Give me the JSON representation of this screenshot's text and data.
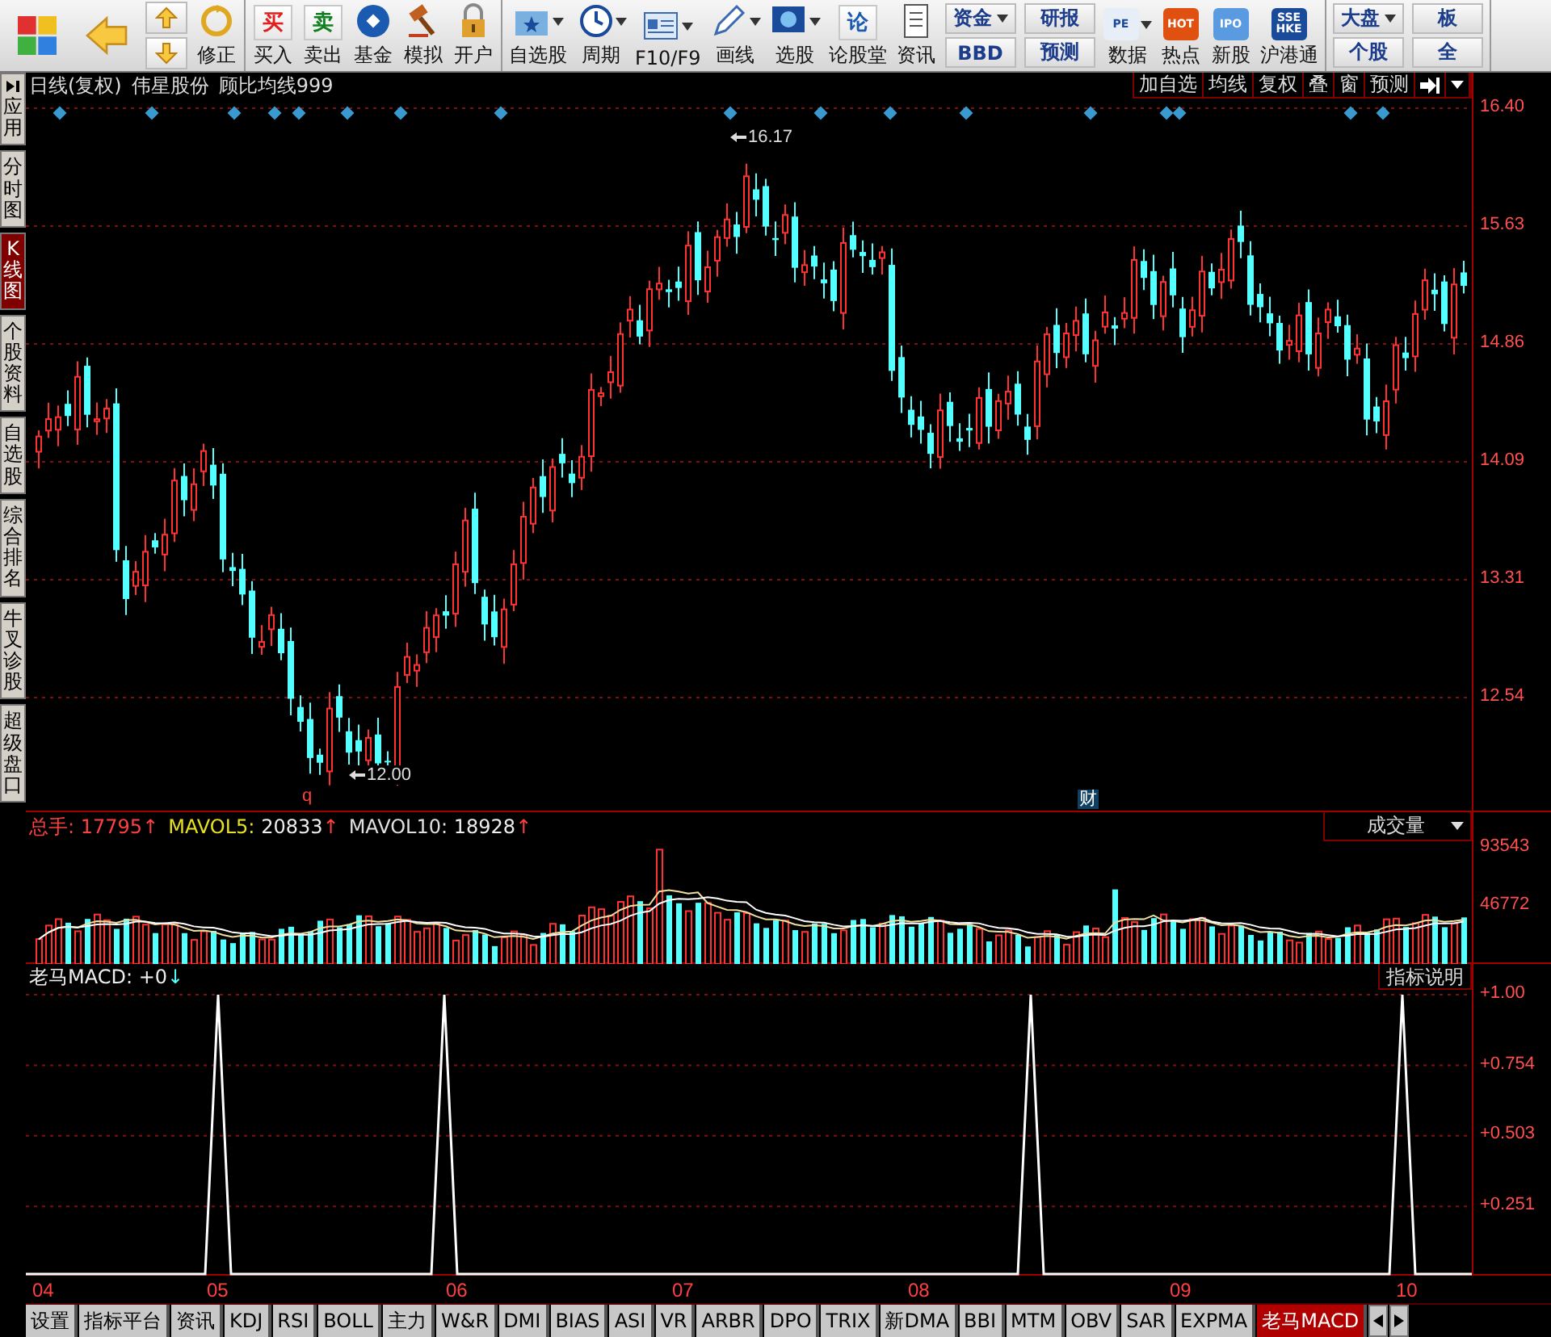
{
  "toolbar": {
    "groups": [
      [
        {
          "kind": "icon",
          "dropdown": false
        },
        {
          "kind": "icon",
          "dropdown": false
        },
        {
          "kind": "arrows"
        },
        {
          "kind": "icon",
          "label": "修正",
          "dropdown": false
        }
      ],
      [
        {
          "kind": "glyph",
          "glyph": "买",
          "label": "买入",
          "dropdown": false
        },
        {
          "kind": "glyph",
          "glyph": "卖",
          "label": "卖出",
          "dropdown": false
        },
        {
          "kind": "icon",
          "label": "基金",
          "dropdown": false
        },
        {
          "kind": "icon",
          "label": "模拟",
          "dropdown": false
        },
        {
          "kind": "icon",
          "label": "开户",
          "dropdown": false
        }
      ],
      [
        {
          "kind": "icon",
          "label": "自选股",
          "dropdown": true
        },
        {
          "kind": "icon",
          "label": "周期",
          "dropdown": true
        },
        {
          "kind": "icon",
          "label": "F10/F9",
          "dropdown": true
        },
        {
          "kind": "icon",
          "label": "画线",
          "dropdown": true
        },
        {
          "kind": "icon",
          "label": "选股",
          "dropdown": true
        },
        {
          "kind": "glyph",
          "glyph": "论",
          "label": "论股堂",
          "dropdown": false
        },
        {
          "kind": "icon",
          "label": "资讯",
          "dropdown": false
        },
        {
          "kind": "stack",
          "buttons": [
            {
              "label": "资金",
              "dropdown": true
            },
            {
              "label": "BBD",
              "dropdown": false
            }
          ]
        },
        {
          "kind": "stack",
          "buttons": [
            {
              "label": "研报",
              "dropdown": false
            },
            {
              "label": "预测",
              "dropdown": false
            }
          ]
        },
        {
          "kind": "glyph",
          "glyph": "PE",
          "label": "数据",
          "dropdown": true
        },
        {
          "kind": "glyph",
          "glyph": "HOT",
          "label": "热点",
          "dropdown": false
        },
        {
          "kind": "glyph",
          "glyph": "IPO",
          "label": "新股",
          "dropdown": false
        },
        {
          "kind": "glyph",
          "glyph": "SSE HKE",
          "label": "沪港通",
          "dropdown": false
        }
      ],
      [
        {
          "kind": "stack",
          "buttons": [
            {
              "label": "大盘",
              "dropdown": true
            },
            {
              "label": "个股",
              "dropdown": false
            }
          ]
        },
        {
          "kind": "stack",
          "buttons": [
            {
              "label": "板",
              "dropdown": false
            },
            {
              "label": "全",
              "dropdown": false
            }
          ]
        }
      ]
    ]
  },
  "sidebar": {
    "items": [
      {
        "label": "应用",
        "selected": false
      },
      {
        "label": "分时图",
        "selected": false
      },
      {
        "label": "K线图",
        "selected": true
      },
      {
        "label": "个股资料",
        "selected": false
      },
      {
        "label": "自选股",
        "selected": false
      },
      {
        "label": "综合排名",
        "selected": false
      },
      {
        "label": "牛叉诊股",
        "selected": false
      },
      {
        "label": "超级盘口",
        "selected": false
      }
    ]
  },
  "price_chart": {
    "title": [
      "日线(复权)",
      "伟星股份",
      "顾比均线999"
    ],
    "buttons": [
      "加自选",
      "均线",
      "复权",
      "叠",
      "窗",
      "预测"
    ],
    "high_label": "16.17",
    "low_label": "12.00",
    "markers": [
      "q",
      "财"
    ],
    "axis": [
      "16.40",
      "15.63",
      "14.86",
      "14.09",
      "13.31",
      "12.54"
    ]
  },
  "volume_chart": {
    "legend": [
      {
        "label": "总手:",
        "value": "17795",
        "trend": "↑",
        "color": "#ff4040"
      },
      {
        "label": "MAVOL5:",
        "value": "20833",
        "trend": "↑",
        "color": "#e8e020"
      },
      {
        "label": "MAVOL10:",
        "value": "18928",
        "trend": "↑",
        "color": "#e0e0e0"
      }
    ],
    "dropdown": "成交量",
    "axis": [
      "93543",
      "46772"
    ]
  },
  "indicator_chart": {
    "label": "老马MACD:",
    "value": "+0",
    "trend": "↓",
    "button": "指标说明",
    "axis": [
      "+1.00",
      "+0.754",
      "+0.503",
      "+0.251"
    ]
  },
  "date_axis": [
    "04",
    "05",
    "06",
    "07",
    "08",
    "09",
    "10"
  ],
  "bottom_tabs": [
    {
      "label": "设置",
      "selected": false
    },
    {
      "label": "指标平台",
      "selected": false
    },
    {
      "label": "资讯",
      "selected": false
    },
    {
      "label": "KDJ",
      "selected": false
    },
    {
      "label": "RSI",
      "selected": false
    },
    {
      "label": "BOLL",
      "selected": false
    },
    {
      "label": "主力",
      "selected": false
    },
    {
      "label": "W&R",
      "selected": false
    },
    {
      "label": "DMI",
      "selected": false
    },
    {
      "label": "BIAS",
      "selected": false
    },
    {
      "label": "ASI",
      "selected": false
    },
    {
      "label": "VR",
      "selected": false
    },
    {
      "label": "ARBR",
      "selected": false
    },
    {
      "label": "DPO",
      "selected": false
    },
    {
      "label": "TRIX",
      "selected": false
    },
    {
      "label": "新DMA",
      "selected": false
    },
    {
      "label": "BBI",
      "selected": false
    },
    {
      "label": "MTM",
      "selected": false
    },
    {
      "label": "OBV",
      "selected": false
    },
    {
      "label": "SAR",
      "selected": false
    },
    {
      "label": "EXPMA",
      "selected": false
    },
    {
      "label": "老马MACD",
      "selected": true
    }
  ]
}
